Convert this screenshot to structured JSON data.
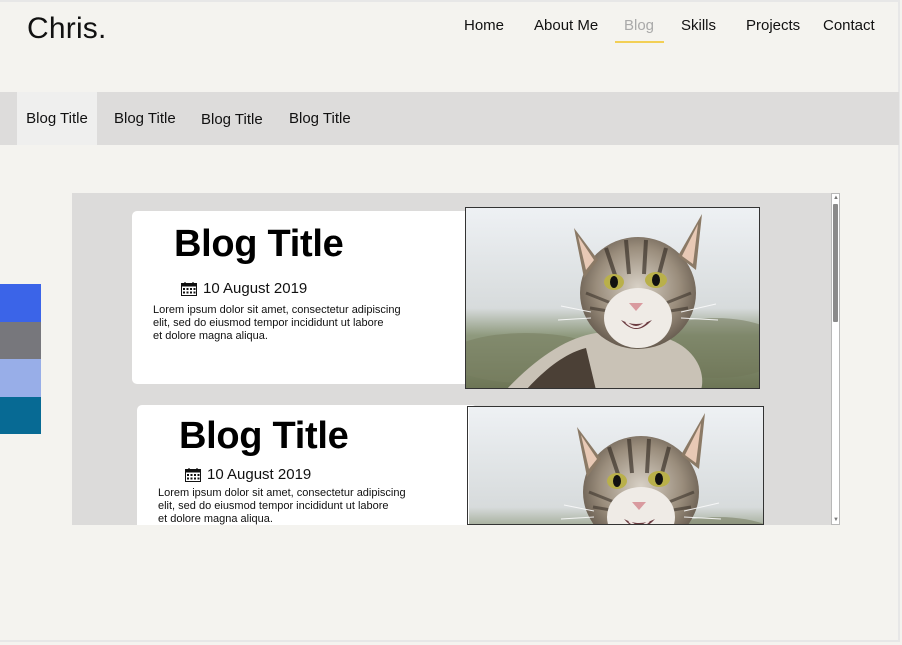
{
  "site": {
    "logo": "Chris."
  },
  "nav": {
    "items": [
      {
        "label": "Home"
      },
      {
        "label": "About Me"
      },
      {
        "label": "Blog"
      },
      {
        "label": "Skills"
      },
      {
        "label": "Projects"
      },
      {
        "label": "Contact"
      }
    ],
    "active": "Blog",
    "active_color": "#a9a9a9",
    "underline_color": "#f2cf55"
  },
  "blog_tabs": [
    {
      "label": "Blog Title"
    },
    {
      "label": "Blog Title"
    },
    {
      "label": "Blog Title"
    },
    {
      "label": "Blog Title"
    }
  ],
  "social_colors": [
    "#3b64e8",
    "#77777c",
    "#98aee8",
    "#076a94"
  ],
  "posts": [
    {
      "title": "Blog Title",
      "date": "10 August 2019",
      "excerpt_lines": [
        "Lorem ipsum dolor sit amet, consectetur adipiscing",
        "elit, sed do eiusmod tempor incididunt ut labore",
        "et dolore magna aliqua."
      ],
      "image": "cat-photo"
    },
    {
      "title": "Blog Title",
      "date": "10 August 2019",
      "excerpt_lines": [
        "Lorem ipsum dolor sit amet, consectetur adipiscing",
        "elit, sed do eiusmod tempor incididunt ut labore",
        "et dolore magna aliqua."
      ],
      "image": "cat-photo"
    }
  ],
  "icons": {
    "date": "calendar-icon"
  }
}
